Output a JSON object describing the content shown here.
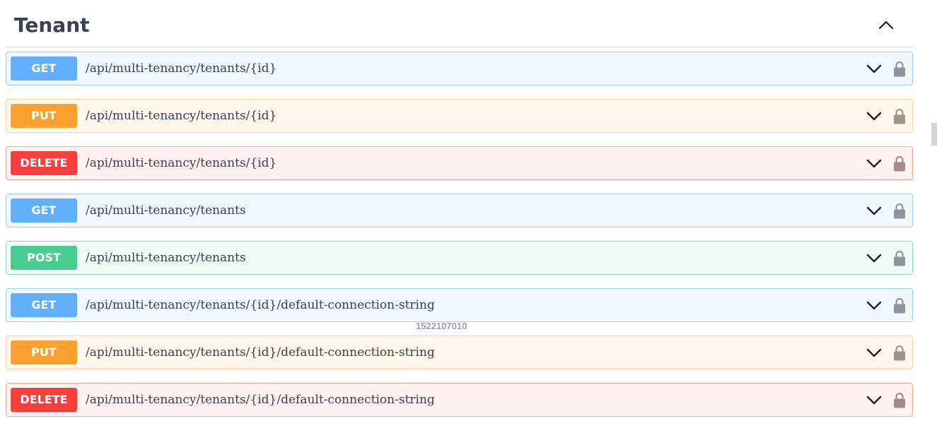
{
  "section": {
    "title": "Tenant",
    "toggle_icon": "chevron-up-icon"
  },
  "operations": [
    {
      "method": "GET",
      "path": "/api/multi-tenancy/tenants/{id}"
    },
    {
      "method": "PUT",
      "path": "/api/multi-tenancy/tenants/{id}"
    },
    {
      "method": "DELETE",
      "path": "/api/multi-tenancy/tenants/{id}"
    },
    {
      "method": "GET",
      "path": "/api/multi-tenancy/tenants"
    },
    {
      "method": "POST",
      "path": "/api/multi-tenancy/tenants"
    },
    {
      "method": "GET",
      "path": "/api/multi-tenancy/tenants/{id}/default-connection-string"
    },
    {
      "method": "PUT",
      "path": "/api/multi-tenancy/tenants/{id}/default-connection-string"
    },
    {
      "method": "DELETE",
      "path": "/api/multi-tenancy/tenants/{id}/default-connection-string"
    }
  ],
  "watermark": "1522107010",
  "colors": {
    "get": "#61affe",
    "put": "#fca130",
    "delete": "#f93e3e",
    "post": "#49cc90",
    "text": "#3b4151"
  }
}
